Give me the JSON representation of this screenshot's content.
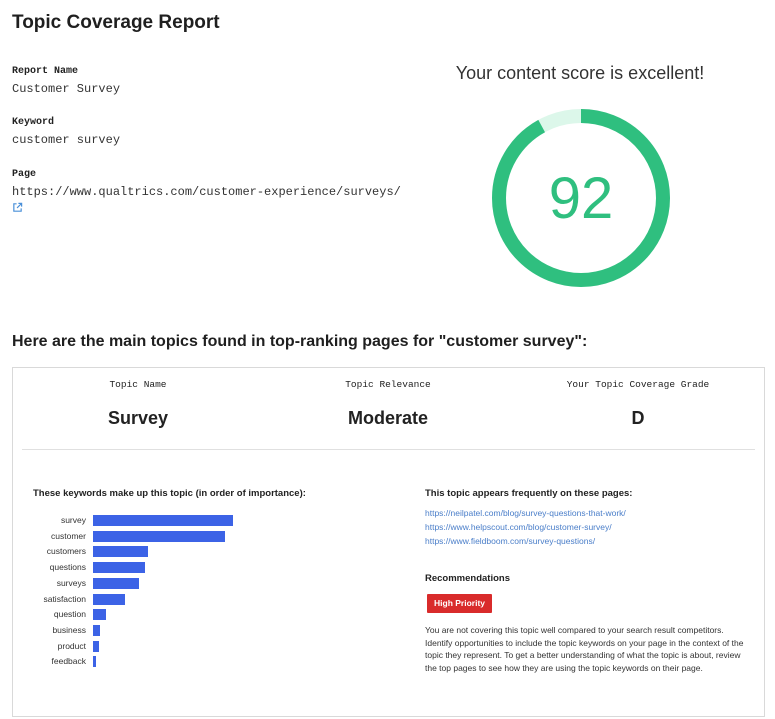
{
  "page_title": "Topic Coverage Report",
  "report": {
    "report_name_label": "Report Name",
    "report_name": "Customer Survey",
    "keyword_label": "Keyword",
    "keyword": "customer survey",
    "page_label": "Page",
    "page_url": "https://www.qualtrics.com/customer-experience/surveys/",
    "external_link_icon": "external-link-icon"
  },
  "score": {
    "heading": "Your content score is excellent!",
    "value": "92",
    "max": 100,
    "ring_color": "#2fbf7f",
    "ring_track_color": "#dcf7ea"
  },
  "topics_heading": "Here are the main topics found in top-ranking pages for \"customer survey\":",
  "topic": {
    "name_label": "Topic Name",
    "name": "Survey",
    "relevance_label": "Topic Relevance",
    "relevance": "Moderate",
    "grade_label": "Your Topic Coverage Grade",
    "grade": "D"
  },
  "keywords_heading": "These keywords make up this topic (in order of importance):",
  "chart_data": {
    "type": "bar",
    "orientation": "horizontal",
    "categories": [
      "survey",
      "customer",
      "customers",
      "questions",
      "surveys",
      "satisfaction",
      "question",
      "business",
      "product",
      "feedback"
    ],
    "values": [
      100,
      94,
      39,
      37,
      33,
      23,
      9,
      5,
      4,
      2
    ],
    "bar_color": "#3c63e6",
    "xlim": [
      0,
      100
    ]
  },
  "pages_heading": "This topic appears frequently on these pages:",
  "pages": [
    "https://neilpatel.com/blog/survey-questions-that-work/",
    "https://www.helpscout.com/blog/customer-survey/",
    "https://www.fieldboom.com/survey-questions/"
  ],
  "recommendations": {
    "heading": "Recommendations",
    "badge": "High Priority",
    "badge_color": "#d92b2b",
    "text": "You are not covering this topic well compared to your search result competitors. Identify opportunities to include the topic keywords on your page in the context of the topic they represent. To get a better understanding of what the topic is about, review the top pages to see how they are using the topic keywords on their page."
  }
}
